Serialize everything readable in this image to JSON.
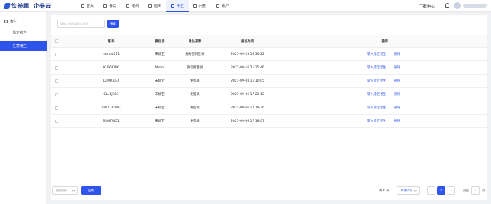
{
  "app": {
    "brand": "铁卷题",
    "sub_brand": "企卷云"
  },
  "nav": {
    "items": [
      {
        "label": "首页",
        "icon": "home-icon"
      },
      {
        "label": "考试",
        "icon": "exam-icon"
      },
      {
        "label": "培训",
        "icon": "training-icon"
      },
      {
        "label": "题库",
        "icon": "question-bank-icon"
      },
      {
        "label": "考生",
        "icon": "user-icon"
      },
      {
        "label": "问卷",
        "icon": "survey-icon"
      },
      {
        "label": "账户",
        "icon": "account-icon"
      }
    ],
    "active_index": 4,
    "download_label": "下载中心"
  },
  "sidebar": {
    "header": "考生",
    "items": [
      {
        "label": "指定考生"
      },
      {
        "label": "任意考生"
      }
    ],
    "active_index": 1
  },
  "search": {
    "placeholder": "请输入账号或微信昵称",
    "button_label": "搜索"
  },
  "table": {
    "columns": [
      "账号",
      "微信号",
      "考生来源",
      "报名时间",
      "操作"
    ],
    "rows": [
      {
        "account": "manbu111",
        "wechat": "未绑定",
        "source": "账号密码登录",
        "time": "2021-09-23 16:36:22",
        "op1": "转入指定考生",
        "op2": "删除"
      },
      {
        "account": "KU96KUIY",
        "wechat": "Moon",
        "source": "微信免登录",
        "time": "2021-09-16 21:25:46",
        "op1": "转入指定考生",
        "op2": "删除"
      },
      {
        "account": "LDMKB6O",
        "wechat": "未绑定",
        "source": "免登录",
        "time": "2021-09-08 11:10:05",
        "op1": "转入指定考生",
        "op2": "删除"
      },
      {
        "account": "CLL4JR3E",
        "wechat": "未绑定",
        "source": "免登录",
        "time": "2021-09-06 17:22:12",
        "op1": "转入指定考生",
        "op2": "删除"
      },
      {
        "account": "4ROU3DWH",
        "wechat": "未绑定",
        "source": "免登录",
        "time": "2021-09-06 17:19:36",
        "op1": "转入指定考生",
        "op2": "删除"
      },
      {
        "account": "SS0ITWO1",
        "wechat": "未绑定",
        "source": "免登录",
        "time": "2021-09-06 17:18:07",
        "op1": "转入指定考生",
        "op2": "删除"
      }
    ]
  },
  "footer": {
    "batch_placeholder": "批量操作",
    "apply_label": "应用",
    "total_text": "共 6 条",
    "page_size": "10条/页",
    "prev": "‹",
    "current_page": "1",
    "next": "›",
    "goto_label": "前往",
    "goto_value": "1",
    "goto_unit": "页"
  },
  "colors": {
    "accent": "#2f54eb",
    "brand": "#1f3d8a"
  }
}
